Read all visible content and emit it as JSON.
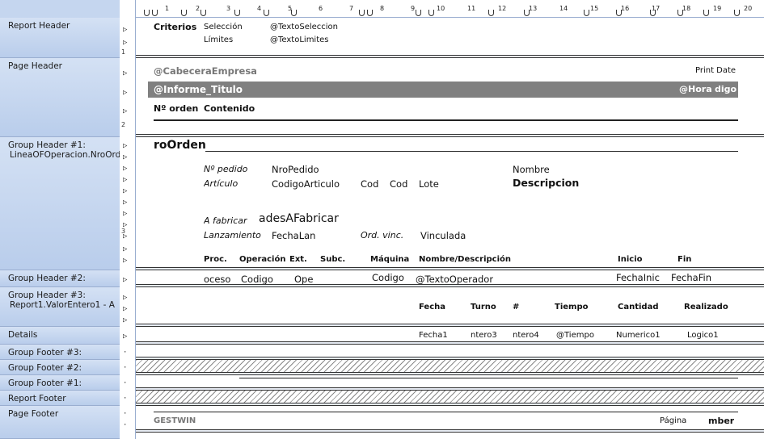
{
  "sections": [
    {
      "name": "Report Header",
      "sub": ""
    },
    {
      "name": "Page Header",
      "sub": ""
    },
    {
      "name": "Group Header #1:",
      "sub": "LineaOFOperacion.NroOrde"
    },
    {
      "name": "Group Header #2:",
      "sub": ""
    },
    {
      "name": "Group Header #3:",
      "sub": "Report1.ValorEntero1 - A"
    },
    {
      "name": "Details",
      "sub": ""
    },
    {
      "name": "Group Footer #3:",
      "sub": ""
    },
    {
      "name": "Group Footer #2:",
      "sub": ""
    },
    {
      "name": "Group Footer #1:",
      "sub": ""
    },
    {
      "name": "Report Footer",
      "sub": ""
    },
    {
      "name": "Page Footer",
      "sub": ""
    }
  ],
  "ruler": {
    "ticks": [
      "1",
      "2",
      "3",
      "4",
      "5",
      "6",
      "7",
      "8",
      "9",
      "10",
      "11",
      "12",
      "13",
      "14",
      "15",
      "16",
      "17",
      "18",
      "19",
      "20"
    ]
  },
  "vruler": {
    "r1": "1",
    "r2": "2",
    "r3": "3"
  },
  "report_header": {
    "criterios": "Criterios",
    "seleccion": "Selección",
    "limites": "Límites",
    "texto_seleccion": "@TextoSeleccion",
    "texto_limites": "@TextoLimites"
  },
  "page_header": {
    "cabecera": "@CabeceraEmpresa",
    "print_date": "Print Date",
    "informe_titulo": "@Informe_Titulo",
    "hora": "@Hora",
    "codigo": "digo",
    "nro_orden": "Nº orden",
    "contenido": "Contenido"
  },
  "group_header_1": {
    "nro_orden": "roOrden",
    "n_pedido_label": "Nº pedido",
    "nro_pedido": "NroPedido",
    "nombre_label": "Nombre",
    "articulo_label": "Artículo",
    "codigo_articulo": "CodigoArticulo",
    "cod1": "Cod",
    "cod2": "Cod",
    "lote": "Lote",
    "descripcion": "Descripcion",
    "a_fabricar_label": "A fabricar",
    "unidades_fabricar": "adesAFabricar",
    "lanzamiento_label": "Lanzamiento",
    "fecha_lan": "FechaLan",
    "ord_vinc_label": "Ord. vinc.",
    "vinculada": "Vinculada",
    "col_proc": "Proc.",
    "col_operacion": "Operación",
    "col_ext": "Ext.",
    "col_subc": "Subc.",
    "col_maquina": "Máquina",
    "col_nombre_desc": "Nombre/Descripción",
    "col_inicio": "Inicio",
    "col_fin": "Fin"
  },
  "group_header_2": {
    "proceso": "oceso",
    "codigo1": "Codigo",
    "ope": "Ope",
    "codigo2": "Codigo",
    "texto_operador": "@TextoOperador",
    "fecha_inic": "FechaInic",
    "fecha_fin": "FechaFin"
  },
  "group_header_3": {
    "fecha": "Fecha",
    "turno": "Turno",
    "num": "#",
    "tiempo": "Tiempo",
    "cantidad": "Cantidad",
    "realizado": "Realizado"
  },
  "details": {
    "fecha1": "Fecha1",
    "entero3": "ntero3",
    "entero4": "ntero4",
    "tiempo": "@Tiempo",
    "numerico1": "Numerico1",
    "logico1": "Logico1"
  },
  "page_footer": {
    "gestwin": "GESTWIN",
    "pagina": "Página",
    "number": "mber"
  }
}
